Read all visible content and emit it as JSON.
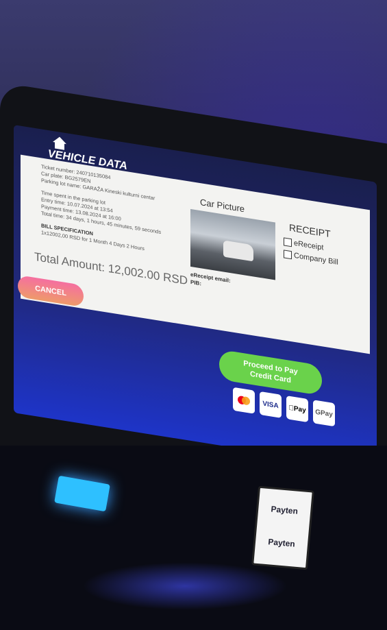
{
  "screen": {
    "title": "VEHICLE DATA",
    "ticket_info": [
      "Ticket number: 240710135084",
      "Car plate: BG2579EN",
      "Parking lot name: GARAŽA Kineski kulturni centar"
    ],
    "time_info": [
      "Time spent in the parking lot",
      "Entry time: 10.07.2024 at 13:54",
      "Payment time: 13.08.2024 at 16:00",
      "Total time: 34 days, 1 hours, 45 minutes, 59 seconds"
    ],
    "bill": {
      "heading": "BILL SPECIFICATION",
      "line": "1x12002,00 RSD for 1 Month 4 Days 2 Hours"
    },
    "total_amount": "Total Amount: 12,002.00 RSD",
    "car_picture_title": "Car Picture",
    "ereceipt_email_label": "eReceipt email:",
    "pib_label": "PIB:",
    "receipt": {
      "title": "RECEIPT",
      "options": [
        "eReceipt",
        "Company Bill"
      ]
    },
    "cancel_label": "CANCEL",
    "proceed_label_1": "Proceed to Pay",
    "proceed_label_2": "Credit Card",
    "payment_methods": [
      "VISA",
      "Pay",
      "GPay"
    ],
    "languages": [
      "serbian-flag",
      "uk-flag",
      "china-flag"
    ]
  },
  "terminal": {
    "brand_1": "Payten",
    "brand_2": "Payten"
  }
}
